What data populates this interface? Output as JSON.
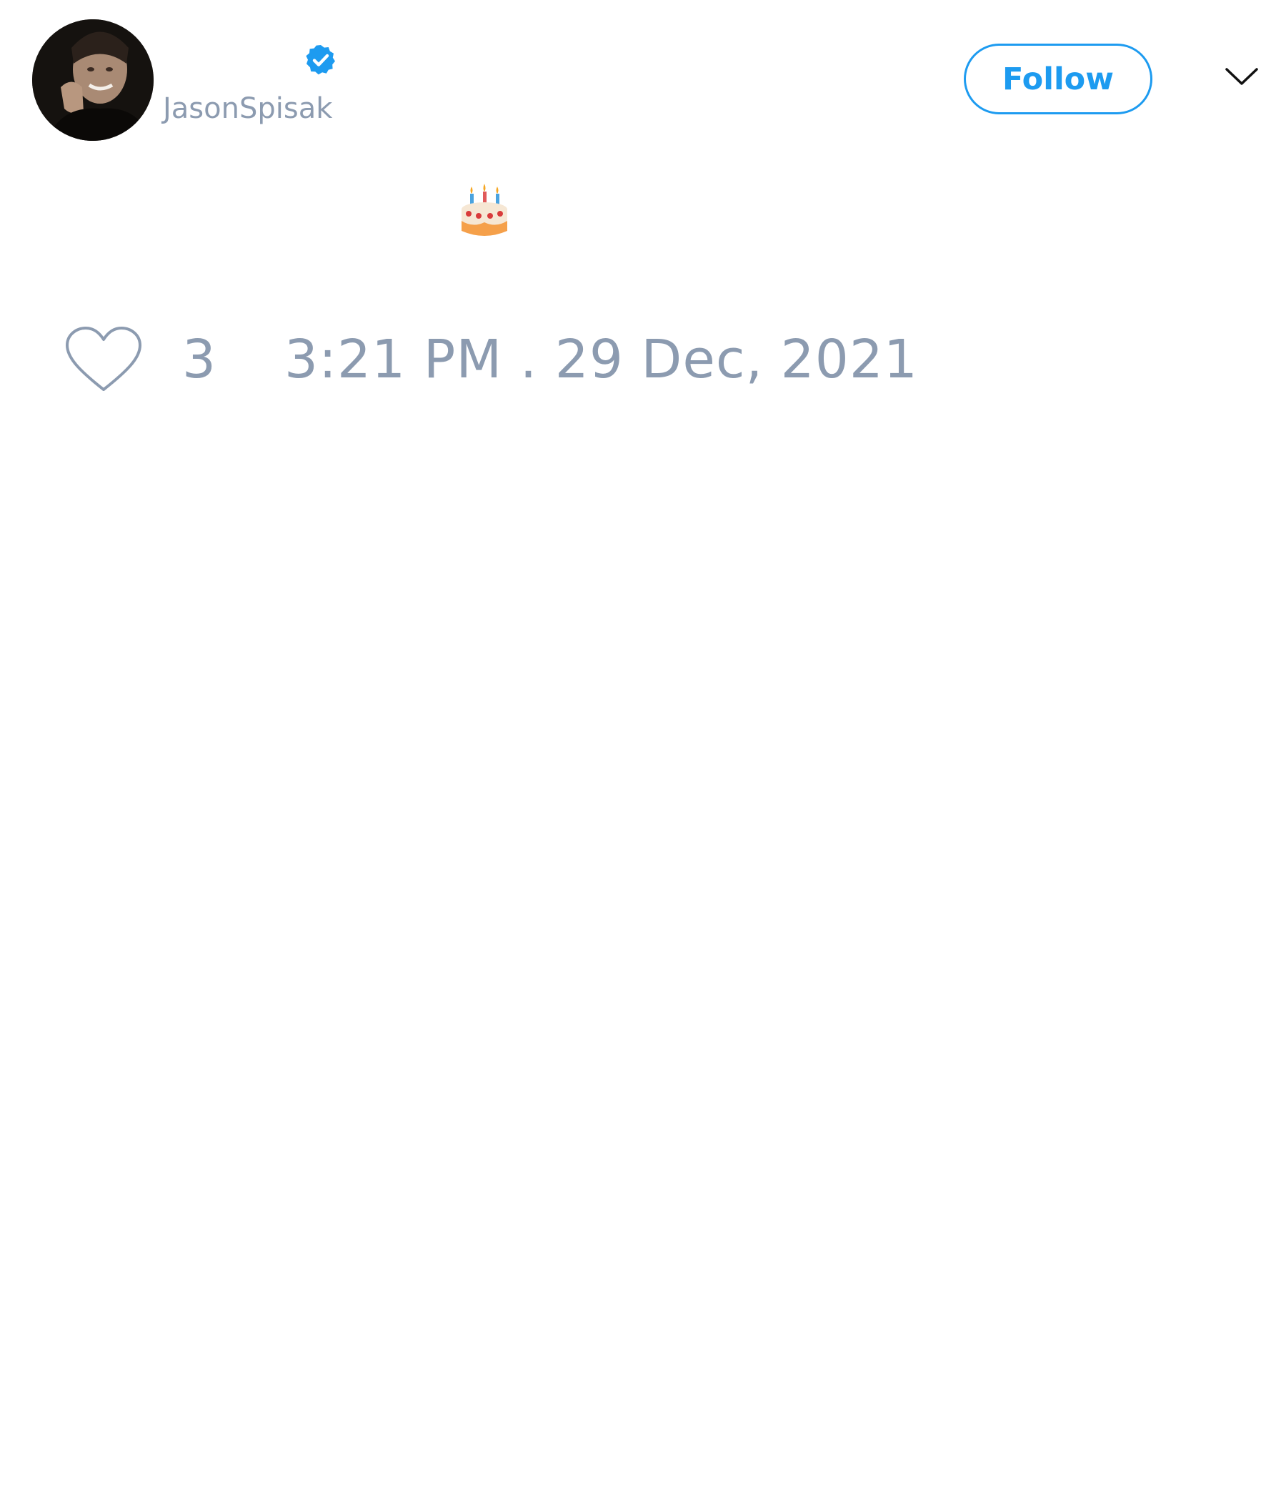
{
  "tweet": {
    "author": {
      "handle": "JasonSpisak",
      "verified": true,
      "avatar_icon": "profile-photo"
    },
    "follow_label": "Follow",
    "menu_icon": "chevron-down-icon",
    "body_emoji_icon": "birthday-cake-icon",
    "likes": "3",
    "like_icon": "heart-outline-icon",
    "timestamp": "3:21 PM . 29 Dec, 2021"
  },
  "colors": {
    "accent": "#1d9bf0",
    "muted_text": "#8c9bb0",
    "background": "#ffffff"
  }
}
